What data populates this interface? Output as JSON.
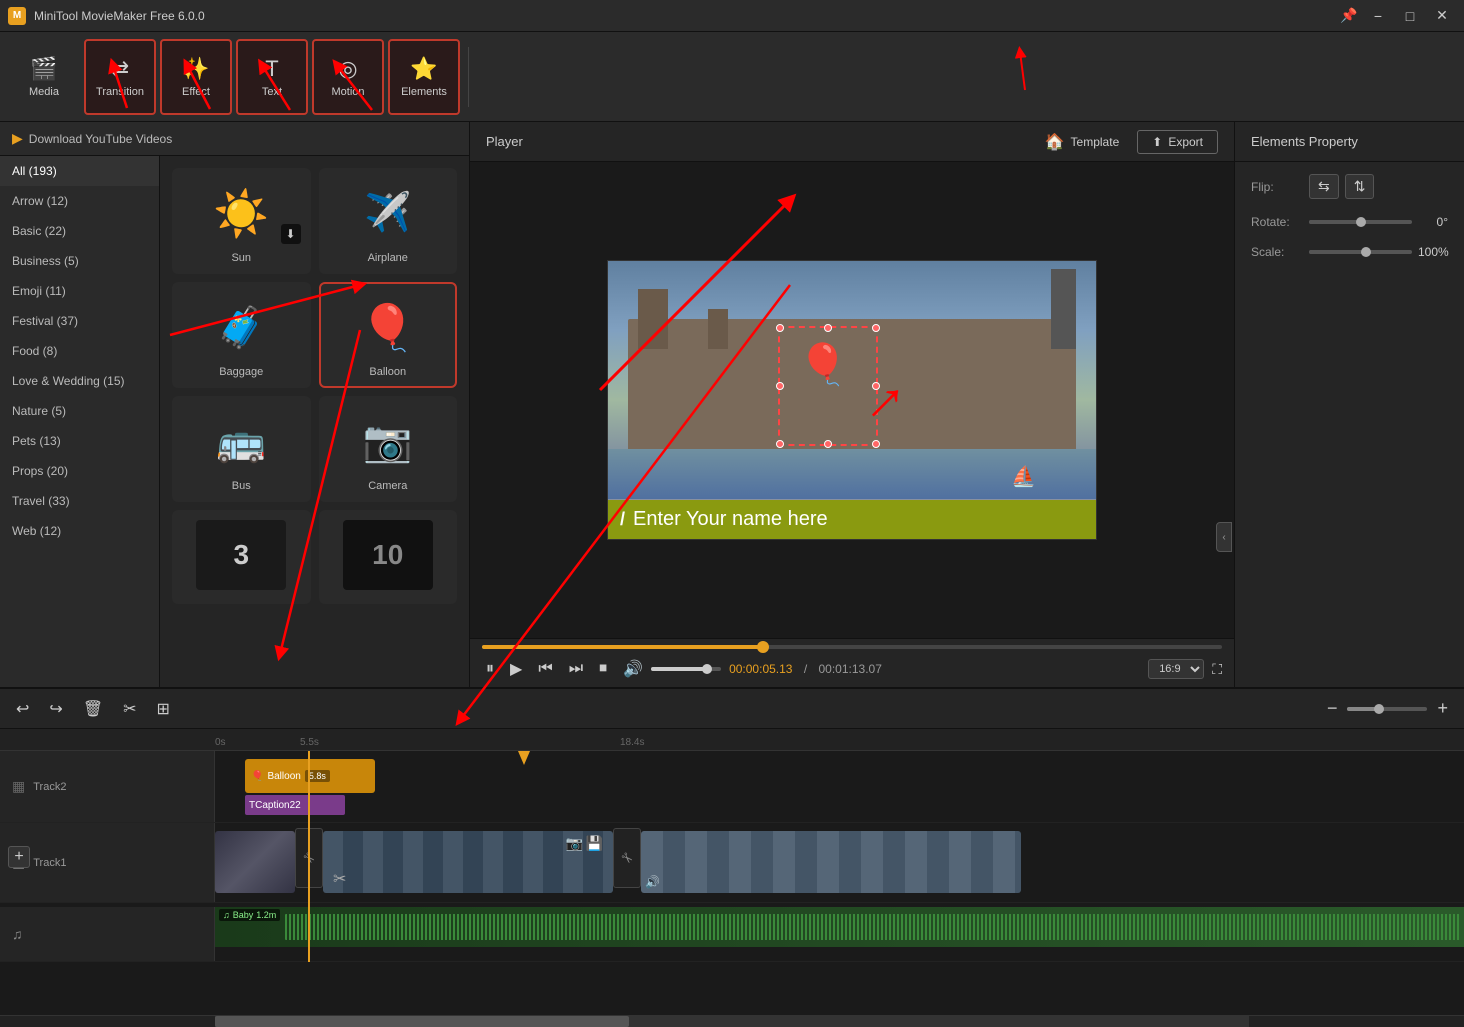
{
  "titlebar": {
    "icon": "M",
    "title": "MiniTool MovieMaker Free 6.0.0",
    "pin_icon": "📌",
    "minimize": "−",
    "maximize": "□",
    "close": "✕"
  },
  "toolbar": {
    "media_label": "Media",
    "transition_label": "Transition",
    "effect_label": "Effect",
    "text_label": "Text",
    "motion_label": "Motion",
    "elements_label": "Elements"
  },
  "categories": [
    {
      "id": "all",
      "label": "All (193)",
      "active": true
    },
    {
      "id": "arrow",
      "label": "Arrow (12)"
    },
    {
      "id": "basic",
      "label": "Basic (22)"
    },
    {
      "id": "business",
      "label": "Business (5)"
    },
    {
      "id": "emoji",
      "label": "Emoji (11)"
    },
    {
      "id": "festival",
      "label": "Festival (37)"
    },
    {
      "id": "food",
      "label": "Food (8)"
    },
    {
      "id": "love",
      "label": "Love & Wedding (15)"
    },
    {
      "id": "nature",
      "label": "Nature (5)"
    },
    {
      "id": "pets",
      "label": "Pets (13)"
    },
    {
      "id": "props",
      "label": "Props (20)"
    },
    {
      "id": "travel",
      "label": "Travel (33)"
    },
    {
      "id": "web",
      "label": "Web (12)"
    }
  ],
  "download_bar": {
    "icon": "▶",
    "label": "Download YouTube Videos"
  },
  "elements": [
    {
      "id": "sun",
      "emoji": "☀️",
      "label": "Sun",
      "has_download": true
    },
    {
      "id": "airplane",
      "emoji": "✈️",
      "label": "Airplane",
      "has_download": false
    },
    {
      "id": "baggage",
      "emoji": "🧳",
      "label": "Baggage",
      "has_download": false
    },
    {
      "id": "balloon",
      "emoji": "🎈",
      "label": "Balloon",
      "selected": true,
      "has_download": false
    },
    {
      "id": "bus",
      "emoji": "🚌",
      "label": "Bus",
      "has_download": false
    },
    {
      "id": "camera",
      "emoji": "📷",
      "label": "Camera",
      "has_download": false
    },
    {
      "id": "counter3",
      "type": "counter",
      "value": "3",
      "label": "",
      "dark": false
    },
    {
      "id": "counter10",
      "type": "counter",
      "value": "10",
      "label": "",
      "dark": true
    }
  ],
  "player": {
    "title": "Player",
    "caption_text": "Enter Your name here",
    "time_current": "00:00:05.13",
    "time_separator": "/",
    "time_total": "00:01:13.07",
    "aspect_ratio": "16:9",
    "volume": 80,
    "progress": 38
  },
  "template_btn": "Template",
  "export_btn": "Export",
  "properties": {
    "title": "Elements Property",
    "flip_label": "Flip:",
    "rotate_label": "Rotate:",
    "rotate_value": "0°",
    "scale_label": "Scale:",
    "scale_value": "100%"
  },
  "timeline": {
    "time_marks": [
      "0s",
      "5.5s",
      "18.4s"
    ],
    "track2_label": "Track2",
    "track1_label": "Track1",
    "balloon_clip": "Balloon",
    "balloon_duration": "5.8s",
    "caption_clip": "Caption22",
    "audio_label": "Baby",
    "audio_duration": "1.2m"
  },
  "controls": {
    "pause_icon": "⏸",
    "play_icon": "▶",
    "prev_icon": "⏮",
    "next_icon": "⏭",
    "stop_icon": "⏹",
    "volume_icon": "🔊",
    "fullscreen_icon": "⛶"
  }
}
